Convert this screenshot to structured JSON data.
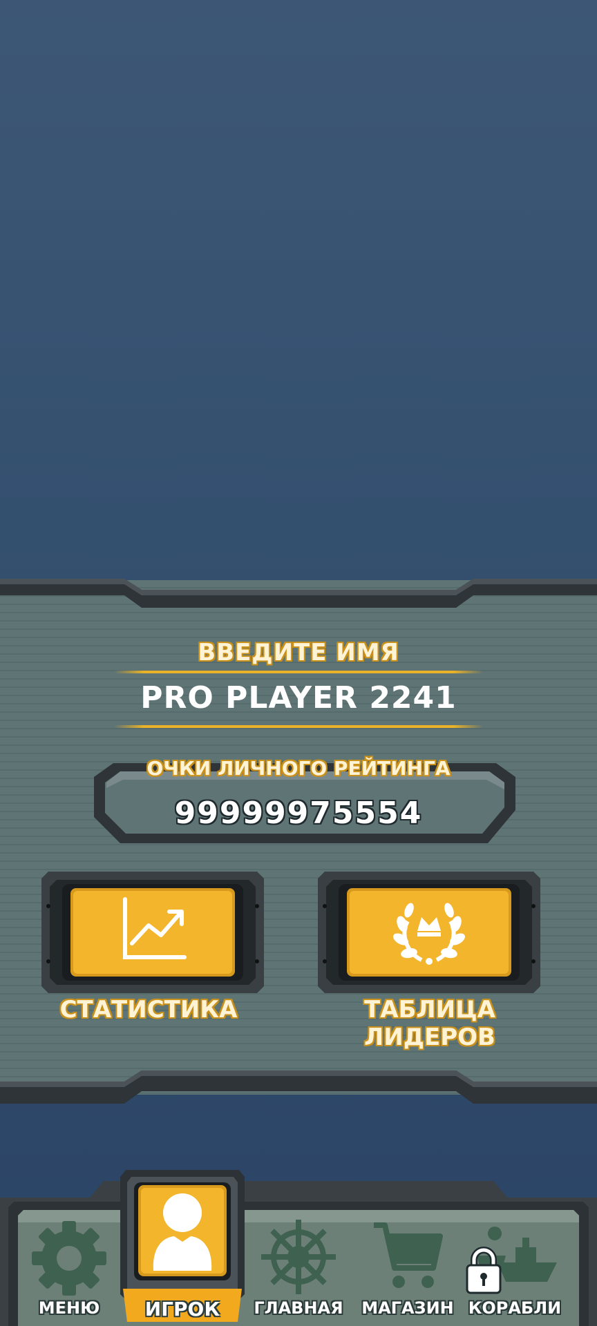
{
  "player": {
    "name_title": "ВВЕДИТЕ ИМЯ",
    "name_value": "PRO PLAYER 2241",
    "rating_title": "ОЧКИ ЛИЧНОГО РЕЙТИНГА",
    "rating_value": "99999975554"
  },
  "actions": {
    "stats_label": "СТАТИСТИКА",
    "stats_icon": "chart-up-icon",
    "leaders_label": "ТАБЛИЦА ЛИДЕРОВ",
    "leaders_icon": "laurel-crown-icon"
  },
  "nav": {
    "items": [
      {
        "label": "МЕНЮ",
        "icon": "gear-icon"
      },
      {
        "label": "ИГРОК",
        "icon": "user-icon",
        "active": true
      },
      {
        "label": "ГЛАВНАЯ",
        "icon": "ship-wheel-icon"
      },
      {
        "label": "МАГАЗИН",
        "icon": "cart-icon"
      },
      {
        "label": "КОРАБЛИ",
        "icon": "ships-lock-icon",
        "locked": true
      }
    ]
  },
  "colors": {
    "accent_gold": "#e9b228",
    "panel": "#5f7474",
    "background": "#34506f",
    "nav_active": "#f2a91e"
  }
}
